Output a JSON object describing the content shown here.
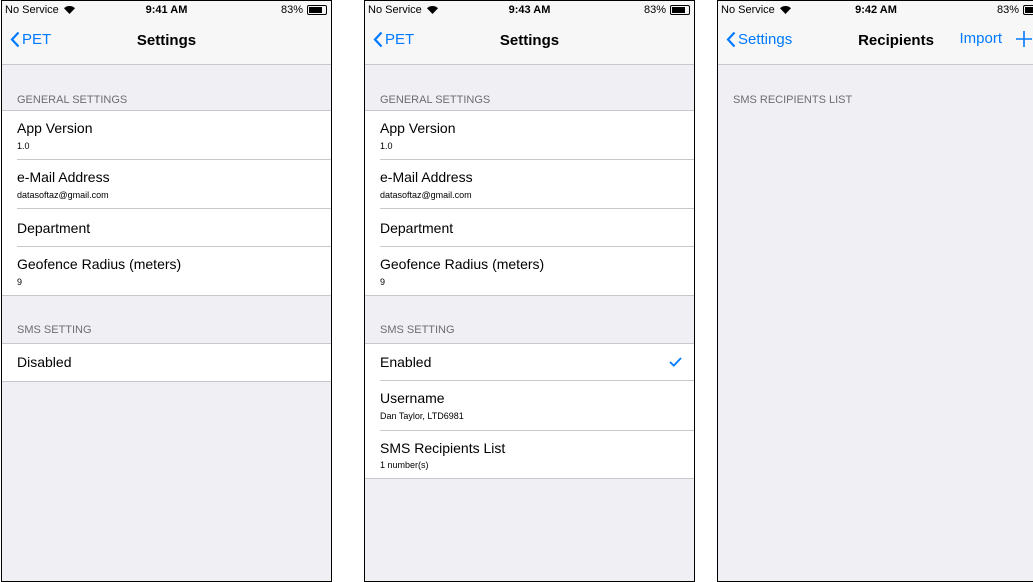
{
  "colors": {
    "accent": "#007aff",
    "background": "#efeff4",
    "separator": "#c8c7cc"
  },
  "screens": [
    {
      "status": {
        "carrier": "No Service",
        "time": "9:41 AM",
        "battery": "83%",
        "battery_level": 0.83
      },
      "nav": {
        "back": "PET",
        "title": "Settings"
      },
      "sections": [
        {
          "header": "GENERAL SETTINGS",
          "cells": [
            {
              "title": "App Version",
              "subtitle": "1.0"
            },
            {
              "title": "e-Mail Address",
              "subtitle": "datasoftaz@gmail.com"
            },
            {
              "title": "Department"
            },
            {
              "title": "Geofence Radius (meters)",
              "subtitle": "9"
            }
          ]
        },
        {
          "header": "SMS SETTING",
          "cells": [
            {
              "title": "Disabled"
            }
          ]
        }
      ]
    },
    {
      "status": {
        "carrier": "No Service",
        "time": "9:43 AM",
        "battery": "83%",
        "battery_level": 0.83
      },
      "nav": {
        "back": "PET",
        "title": "Settings"
      },
      "sections": [
        {
          "header": "GENERAL SETTINGS",
          "cells": [
            {
              "title": "App Version",
              "subtitle": "1.0"
            },
            {
              "title": "e-Mail Address",
              "subtitle": "datasoftaz@gmail.com"
            },
            {
              "title": "Department"
            },
            {
              "title": "Geofence Radius (meters)",
              "subtitle": "9"
            }
          ]
        },
        {
          "header": "SMS SETTING",
          "cells": [
            {
              "title": "Enabled",
              "icon": "checkmark-icon"
            },
            {
              "title": "Username",
              "subtitle": "Dan Taylor, LTD6981"
            },
            {
              "title": "SMS Recipients List",
              "subtitle": "1 number(s)"
            }
          ]
        }
      ]
    },
    {
      "status": {
        "carrier": "No Service",
        "time": "9:42 AM",
        "battery": "83%",
        "battery_level": 0.83
      },
      "nav": {
        "back": "Settings",
        "title": "Recipients",
        "action": "Import",
        "add_icon": "plus-icon"
      },
      "sections": [
        {
          "header": "SMS RECIPIENTS LIST",
          "cells": []
        }
      ]
    }
  ]
}
